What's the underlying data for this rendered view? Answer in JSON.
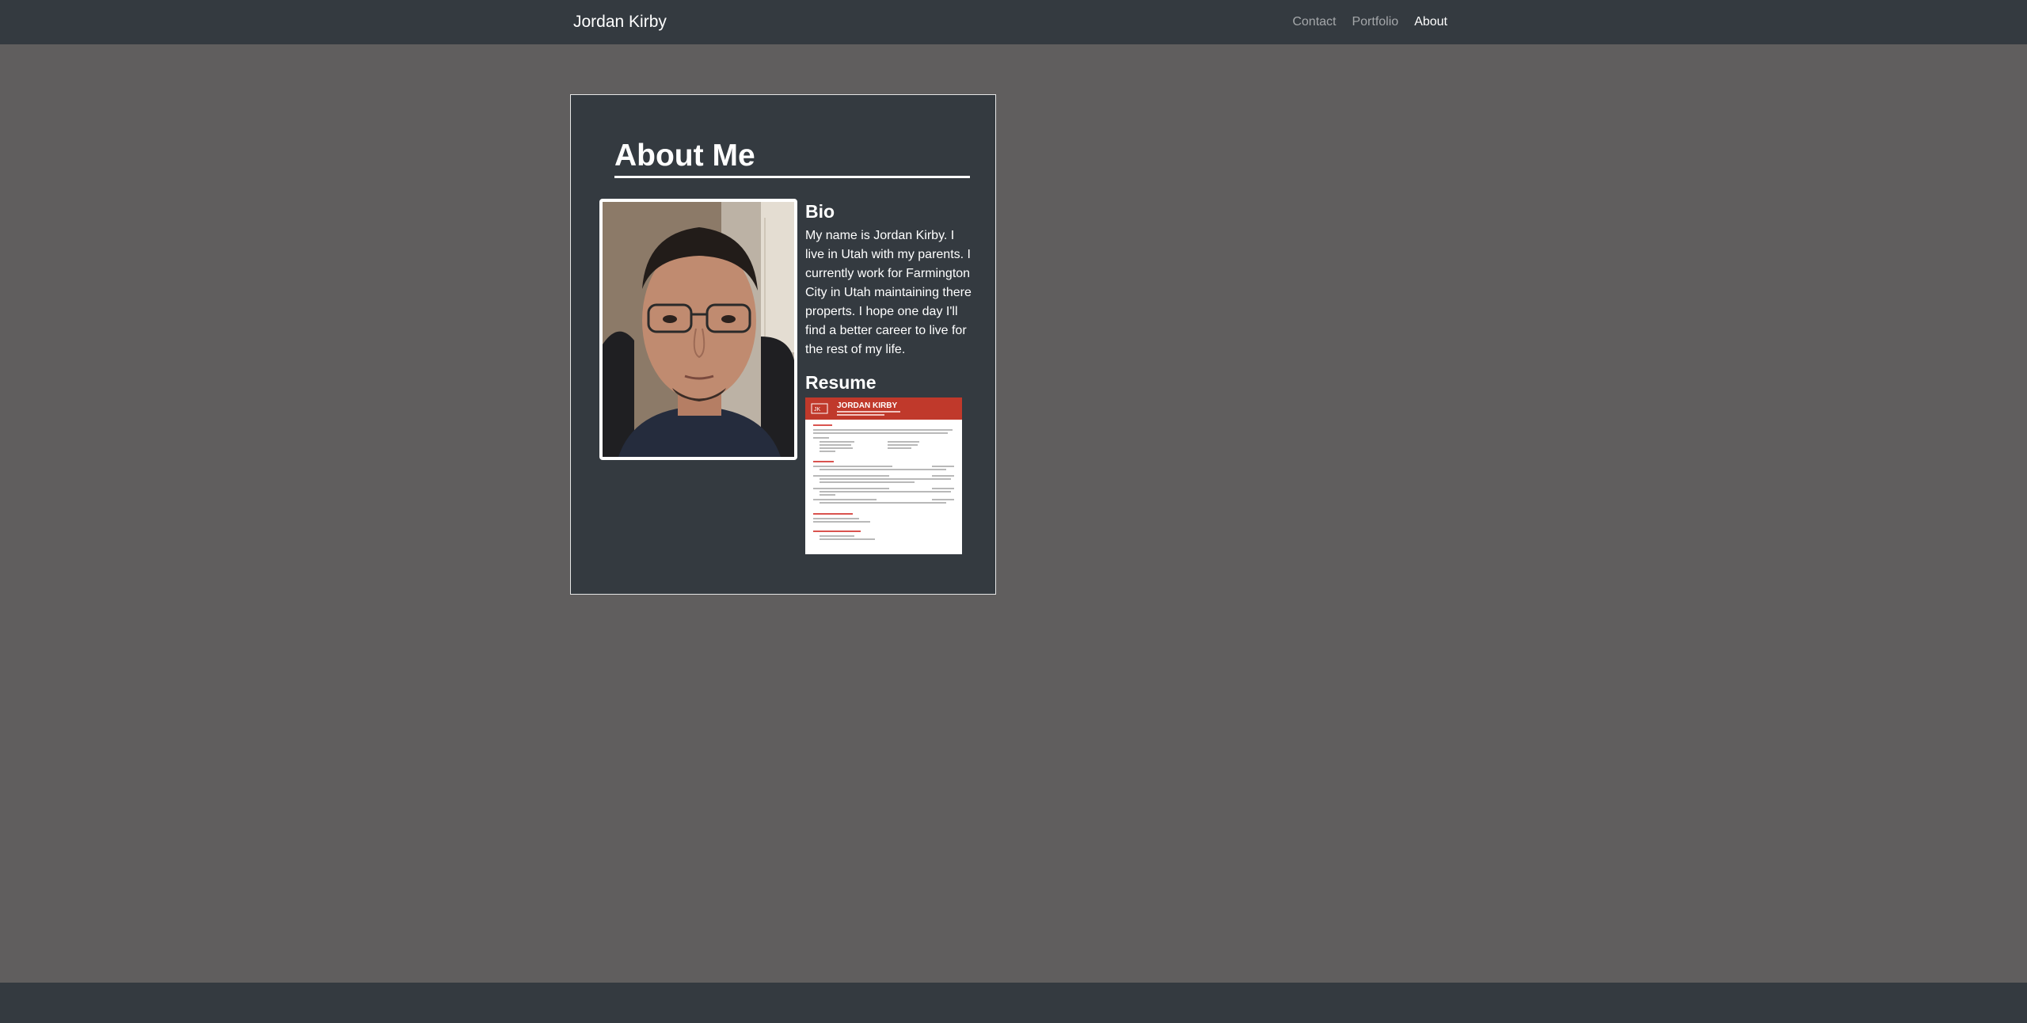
{
  "navbar": {
    "brand": "Jordan Kirby",
    "links": [
      {
        "label": "Contact",
        "active": false
      },
      {
        "label": "Portfolio",
        "active": false
      },
      {
        "label": "About",
        "active": true
      }
    ]
  },
  "about": {
    "title": "About Me",
    "bio_heading": "Bio",
    "bio_text": "My name is Jordan Kirby. I live in Utah with my parents. I currently work for Farmington City in Utah maintaining there properts. I hope one day I'll find a better career to live for the rest of my life.",
    "resume_heading": "Resume",
    "resume_thumb": {
      "initials": "JK",
      "name": "JORDAN KIRBY"
    }
  },
  "colors": {
    "background": "#605e5e",
    "navbar": "#343a40",
    "card": "#343a40",
    "resume_accent": "#c0392b"
  }
}
